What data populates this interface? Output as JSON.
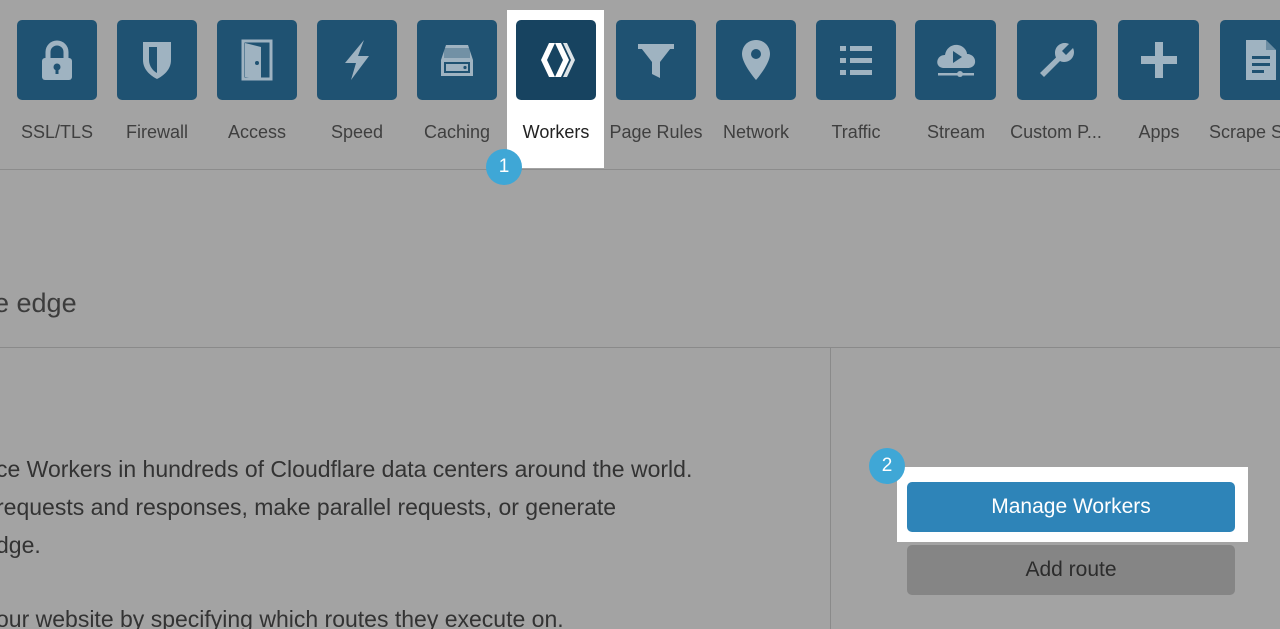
{
  "colors": {
    "overlay_bg": "#a3a3a3",
    "tile": "#1f5272",
    "tile_active": "#174360",
    "callout": "#3fa7d6",
    "primary_button": "#2e84b8",
    "secondary_button": "#858585"
  },
  "nav": {
    "items": [
      {
        "label": "SSL/TLS",
        "icon": "lock-icon"
      },
      {
        "label": "Firewall",
        "icon": "shield-icon"
      },
      {
        "label": "Access",
        "icon": "door-icon"
      },
      {
        "label": "Speed",
        "icon": "lightning-icon"
      },
      {
        "label": "Caching",
        "icon": "server-icon"
      },
      {
        "label": "Workers",
        "icon": "workers-icon",
        "active": true
      },
      {
        "label": "Page Rules",
        "icon": "filter-icon"
      },
      {
        "label": "Network",
        "icon": "location-pin-icon"
      },
      {
        "label": "Traffic",
        "icon": "list-icon"
      },
      {
        "label": "Stream",
        "icon": "cloud-play-icon"
      },
      {
        "label": "Custom P...",
        "icon": "wrench-icon"
      },
      {
        "label": "Apps",
        "icon": "plus-icon"
      },
      {
        "label": "Scrape S",
        "icon": "document-icon"
      }
    ]
  },
  "callouts": {
    "step1": "1",
    "step2": "2"
  },
  "main": {
    "section_title": "e edge",
    "description_lines": [
      "ce Workers in hundreds of Cloudflare data centers around the world.",
      "requests and responses, make parallel requests, or generate",
      "dge.",
      "our website by specifying which routes they execute on."
    ]
  },
  "actions": {
    "manage_workers": "Manage Workers",
    "add_route": "Add route"
  }
}
